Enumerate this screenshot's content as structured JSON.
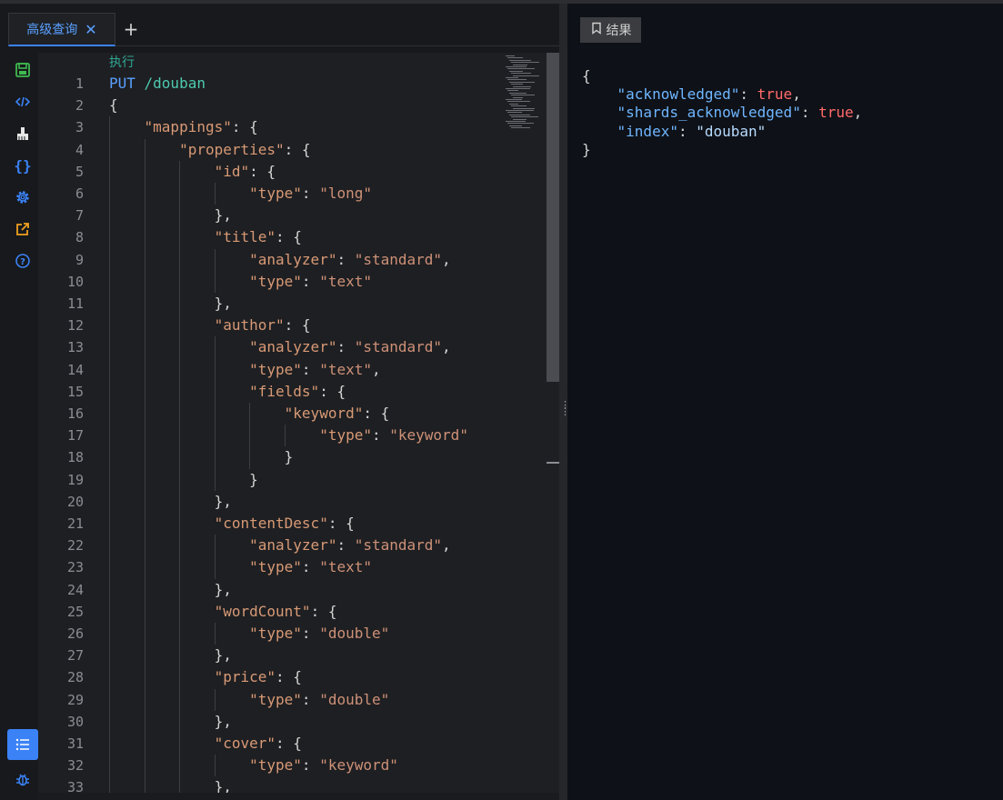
{
  "tabs": [
    {
      "label": "高级查询",
      "close": "✕"
    }
  ],
  "tab_add": "+",
  "rail": {
    "icons": [
      "save-icon",
      "code-icon",
      "broom-icon",
      "braces-icon",
      "settings-icon",
      "external-link-icon",
      "help-icon",
      "list-icon",
      "bug-icon"
    ],
    "braces_glyph": "{}"
  },
  "editor": {
    "exec_label": "执行",
    "lines": [
      {
        "n": "1",
        "tokens": [
          [
            "m",
            "PUT "
          ],
          [
            "p",
            "/douban"
          ]
        ]
      },
      {
        "n": "2",
        "tokens": [
          [
            "d",
            "{"
          ]
        ]
      },
      {
        "n": "3",
        "tokens": [
          [
            "d",
            "    "
          ],
          [
            "k",
            "\"mappings\""
          ],
          [
            "d",
            ": {"
          ]
        ]
      },
      {
        "n": "4",
        "tokens": [
          [
            "d",
            "        "
          ],
          [
            "k",
            "\"properties\""
          ],
          [
            "d",
            ": {"
          ]
        ]
      },
      {
        "n": "5",
        "tokens": [
          [
            "d",
            "            "
          ],
          [
            "k",
            "\"id\""
          ],
          [
            "d",
            ": {"
          ]
        ]
      },
      {
        "n": "6",
        "tokens": [
          [
            "d",
            "                "
          ],
          [
            "k",
            "\"type\""
          ],
          [
            "d",
            ": "
          ],
          [
            "s",
            "\"long\""
          ]
        ]
      },
      {
        "n": "7",
        "tokens": [
          [
            "d",
            "            },"
          ]
        ]
      },
      {
        "n": "8",
        "tokens": [
          [
            "d",
            "            "
          ],
          [
            "k",
            "\"title\""
          ],
          [
            "d",
            ": {"
          ]
        ]
      },
      {
        "n": "9",
        "tokens": [
          [
            "d",
            "                "
          ],
          [
            "k",
            "\"analyzer\""
          ],
          [
            "d",
            ": "
          ],
          [
            "s",
            "\"standard\""
          ],
          [
            "d",
            ","
          ]
        ]
      },
      {
        "n": "10",
        "tokens": [
          [
            "d",
            "                "
          ],
          [
            "k",
            "\"type\""
          ],
          [
            "d",
            ": "
          ],
          [
            "s",
            "\"text\""
          ]
        ]
      },
      {
        "n": "11",
        "tokens": [
          [
            "d",
            "            },"
          ]
        ]
      },
      {
        "n": "12",
        "tokens": [
          [
            "d",
            "            "
          ],
          [
            "k",
            "\"author\""
          ],
          [
            "d",
            ": {"
          ]
        ]
      },
      {
        "n": "13",
        "tokens": [
          [
            "d",
            "                "
          ],
          [
            "k",
            "\"analyzer\""
          ],
          [
            "d",
            ": "
          ],
          [
            "s",
            "\"standard\""
          ],
          [
            "d",
            ","
          ]
        ]
      },
      {
        "n": "14",
        "tokens": [
          [
            "d",
            "                "
          ],
          [
            "k",
            "\"type\""
          ],
          [
            "d",
            ": "
          ],
          [
            "s",
            "\"text\""
          ],
          [
            "d",
            ","
          ]
        ]
      },
      {
        "n": "15",
        "tokens": [
          [
            "d",
            "                "
          ],
          [
            "k",
            "\"fields\""
          ],
          [
            "d",
            ": {"
          ]
        ]
      },
      {
        "n": "16",
        "tokens": [
          [
            "d",
            "                    "
          ],
          [
            "k",
            "\"keyword\""
          ],
          [
            "d",
            ": {"
          ]
        ]
      },
      {
        "n": "17",
        "tokens": [
          [
            "d",
            "                        "
          ],
          [
            "k",
            "\"type\""
          ],
          [
            "d",
            ": "
          ],
          [
            "s",
            "\"keyword\""
          ]
        ]
      },
      {
        "n": "18",
        "tokens": [
          [
            "d",
            "                    }"
          ]
        ]
      },
      {
        "n": "19",
        "tokens": [
          [
            "d",
            "                }"
          ]
        ]
      },
      {
        "n": "20",
        "tokens": [
          [
            "d",
            "            },"
          ]
        ]
      },
      {
        "n": "21",
        "tokens": [
          [
            "d",
            "            "
          ],
          [
            "k",
            "\"contentDesc\""
          ],
          [
            "d",
            ": {"
          ]
        ]
      },
      {
        "n": "22",
        "tokens": [
          [
            "d",
            "                "
          ],
          [
            "k",
            "\"analyzer\""
          ],
          [
            "d",
            ": "
          ],
          [
            "s",
            "\"standard\""
          ],
          [
            "d",
            ","
          ]
        ]
      },
      {
        "n": "23",
        "tokens": [
          [
            "d",
            "                "
          ],
          [
            "k",
            "\"type\""
          ],
          [
            "d",
            ": "
          ],
          [
            "s",
            "\"text\""
          ]
        ]
      },
      {
        "n": "24",
        "tokens": [
          [
            "d",
            "            },"
          ]
        ]
      },
      {
        "n": "25",
        "tokens": [
          [
            "d",
            "            "
          ],
          [
            "k",
            "\"wordCount\""
          ],
          [
            "d",
            ": {"
          ]
        ]
      },
      {
        "n": "26",
        "tokens": [
          [
            "d",
            "                "
          ],
          [
            "k",
            "\"type\""
          ],
          [
            "d",
            ": "
          ],
          [
            "s",
            "\"double\""
          ]
        ]
      },
      {
        "n": "27",
        "tokens": [
          [
            "d",
            "            },"
          ]
        ]
      },
      {
        "n": "28",
        "tokens": [
          [
            "d",
            "            "
          ],
          [
            "k",
            "\"price\""
          ],
          [
            "d",
            ": {"
          ]
        ]
      },
      {
        "n": "29",
        "tokens": [
          [
            "d",
            "                "
          ],
          [
            "k",
            "\"type\""
          ],
          [
            "d",
            ": "
          ],
          [
            "s",
            "\"double\""
          ]
        ]
      },
      {
        "n": "30",
        "tokens": [
          [
            "d",
            "            },"
          ]
        ]
      },
      {
        "n": "31",
        "tokens": [
          [
            "d",
            "            "
          ],
          [
            "k",
            "\"cover\""
          ],
          [
            "d",
            ": {"
          ]
        ]
      },
      {
        "n": "32",
        "tokens": [
          [
            "d",
            "                "
          ],
          [
            "k",
            "\"type\""
          ],
          [
            "d",
            ": "
          ],
          [
            "s",
            "\"keyword\""
          ]
        ]
      },
      {
        "n": "33",
        "tokens": [
          [
            "d",
            "            },"
          ]
        ]
      }
    ]
  },
  "result": {
    "button_label": "结果",
    "lines": [
      [
        [
          "d",
          "{"
        ]
      ],
      [
        [
          "d",
          "    "
        ],
        [
          "rk",
          "\"acknowledged\""
        ],
        [
          "d",
          ": "
        ],
        [
          "rt",
          "true"
        ],
        [
          "d",
          ","
        ]
      ],
      [
        [
          "d",
          "    "
        ],
        [
          "rk",
          "\"shards_acknowledged\""
        ],
        [
          "d",
          ": "
        ],
        [
          "rt",
          "true"
        ],
        [
          "d",
          ","
        ]
      ],
      [
        [
          "d",
          "    "
        ],
        [
          "rk",
          "\"index\""
        ],
        [
          "d",
          ": "
        ],
        [
          "rs",
          "\"douban\""
        ]
      ],
      [
        [
          "d",
          "}"
        ]
      ]
    ]
  }
}
